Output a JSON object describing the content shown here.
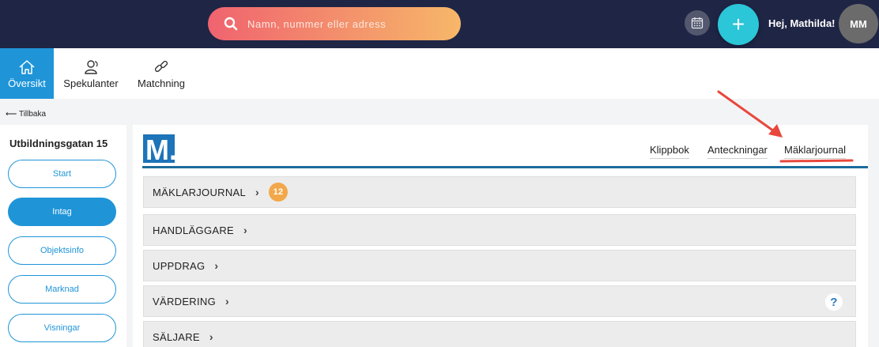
{
  "header": {
    "search_placeholder": "Namn, nummer eller adress",
    "greeting": "Hej, Mathilda!",
    "avatar_initials": "MM",
    "add_label": "+"
  },
  "nav": {
    "items": [
      {
        "label": "Översikt",
        "icon": "home-icon",
        "active": true
      },
      {
        "label": "Spekulanter",
        "icon": "users-icon",
        "active": false
      },
      {
        "label": "Matchning",
        "icon": "link-icon",
        "active": false
      }
    ]
  },
  "back_label": "Tillbaka",
  "sidebar": {
    "title": "Utbildningsgatan 15",
    "buttons": [
      {
        "label": "Start",
        "active": false
      },
      {
        "label": "Intag",
        "active": true
      },
      {
        "label": "Objektsinfo",
        "active": false
      },
      {
        "label": "Marknad",
        "active": false
      },
      {
        "label": "Visningar",
        "active": false
      }
    ]
  },
  "main": {
    "logo_text": "M.",
    "tabs": [
      {
        "label": "Klippbok"
      },
      {
        "label": "Anteckningar"
      },
      {
        "label": "Mäklarjournal"
      }
    ],
    "sections": [
      {
        "label": "MÄKLARJOURNAL",
        "badge": "12"
      },
      {
        "label": "HANDLÄGGARE"
      },
      {
        "label": "UPPDRAG"
      },
      {
        "label": "VÄRDERING",
        "help": "?"
      },
      {
        "label": "SÄLJARE"
      }
    ]
  },
  "colors": {
    "topbar": "#1f2545",
    "accent_blue": "#1f95d8",
    "badge_orange": "#f2a84a",
    "annotation_red": "#e8473c",
    "plus_button": "#2bc6d8"
  }
}
